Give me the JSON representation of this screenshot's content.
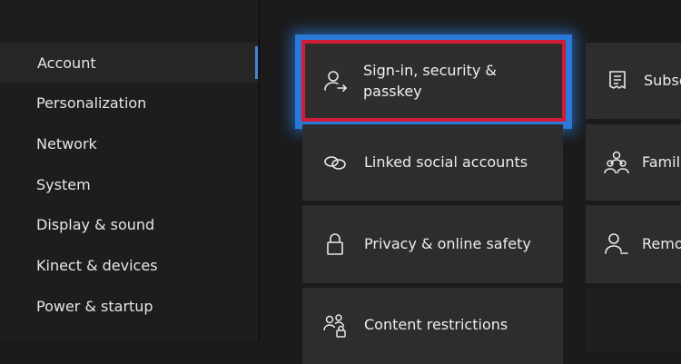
{
  "sidebar": {
    "items": [
      {
        "label": "Account"
      },
      {
        "label": "Personalization"
      },
      {
        "label": "Network"
      },
      {
        "label": "System"
      },
      {
        "label": "Display & sound"
      },
      {
        "label": "Kinect & devices"
      },
      {
        "label": "Power & startup"
      }
    ]
  },
  "tiles": {
    "signin": {
      "line1": "Sign-in, security &",
      "line2": "passkey",
      "icon": "user-arrow-icon"
    },
    "linked": {
      "label": "Linked social accounts",
      "icon": "link-icon"
    },
    "privacy": {
      "label": "Privacy & online safety",
      "icon": "lock-icon"
    },
    "content": {
      "label": "Content restrictions",
      "icon": "family-lock-icon"
    },
    "subscriptions": {
      "label": "Subsc",
      "icon": "receipt-icon"
    },
    "family": {
      "label": "Famil",
      "icon": "family-icon"
    },
    "remove": {
      "label": "Remo",
      "icon": "user-remove-icon"
    }
  },
  "colors": {
    "focus_blue": "#2a78d8",
    "highlight_red": "#d21c36",
    "selection_bar": "#4a84d8",
    "tile_bg": "#2d2d2d"
  }
}
